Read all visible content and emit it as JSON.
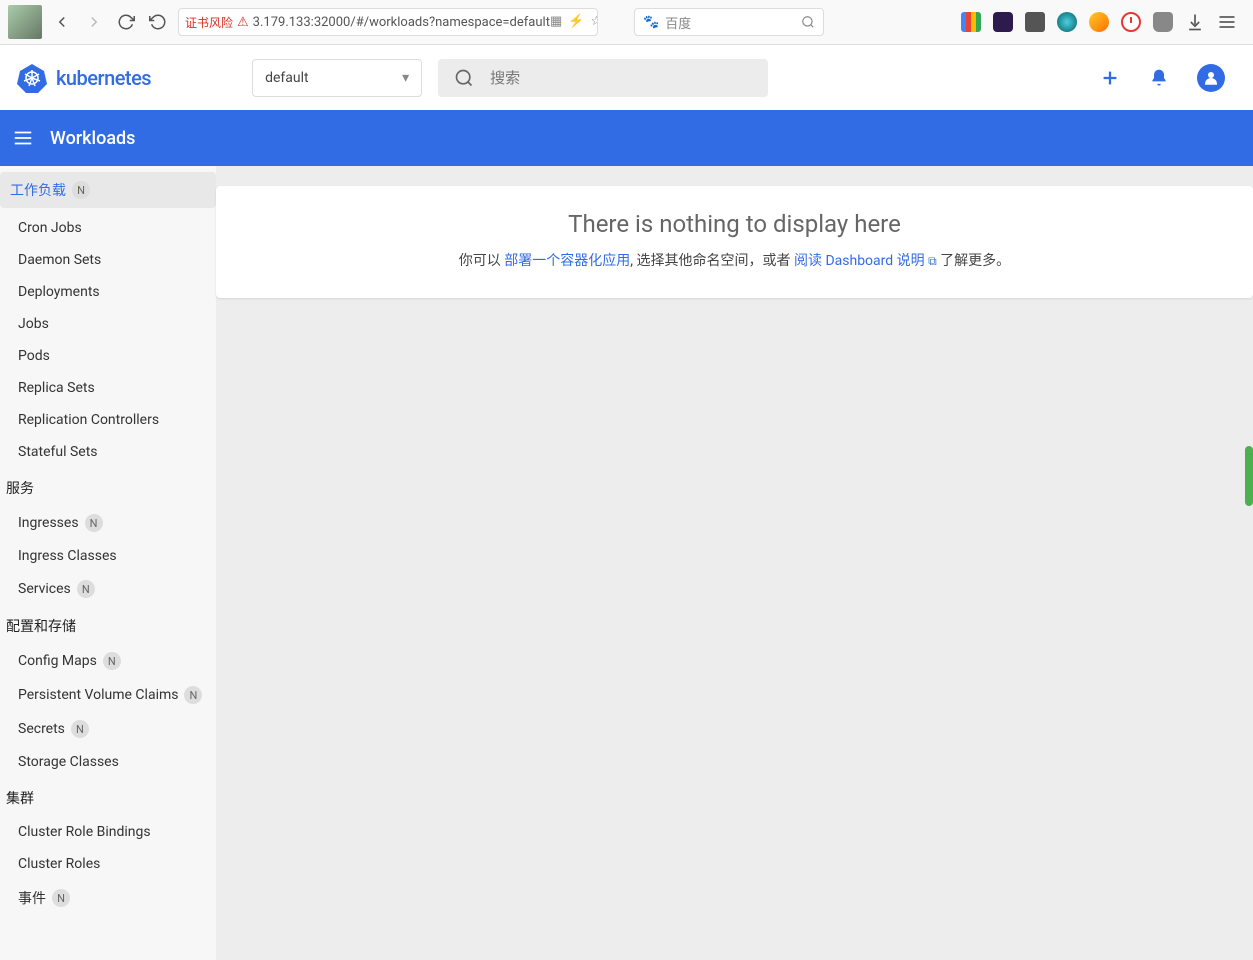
{
  "browser": {
    "url_warn": "证书风险",
    "url": "3.179.133:32000/#/workloads?namespace=default",
    "search_placeholder": "百度"
  },
  "header": {
    "brand": "kubernetes",
    "namespace": "default",
    "search_placeholder": "搜索"
  },
  "pagebar": {
    "title": "Workloads"
  },
  "sidebar": {
    "workloads_label": "工作负载",
    "badge": "N",
    "items": {
      "cron": "Cron Jobs",
      "daemon": "Daemon Sets",
      "deploy": "Deployments",
      "jobs": "Jobs",
      "pods": "Pods",
      "replica": "Replica Sets",
      "rc": "Replication Controllers",
      "stateful": "Stateful Sets"
    },
    "service_section": "服务",
    "service": {
      "ingresses": "Ingresses",
      "ingress_classes": "Ingress Classes",
      "services": "Services"
    },
    "config_section": "配置和存储",
    "config": {
      "cm": "Config Maps",
      "pvc": "Persistent Volume Claims",
      "secrets": "Secrets",
      "sc": "Storage Classes"
    },
    "cluster_section": "集群",
    "cluster": {
      "crb": "Cluster Role Bindings",
      "cr": "Cluster Roles",
      "events": "事件"
    }
  },
  "empty": {
    "title": "There is nothing to display here",
    "pre": "你可以 ",
    "link1": "部署一个容器化应用",
    "mid": ", 选择其他命名空间，或者 ",
    "link2": "阅读 Dashboard 说明",
    "ext_icon": "⧉",
    "post": " 了解更多。"
  }
}
